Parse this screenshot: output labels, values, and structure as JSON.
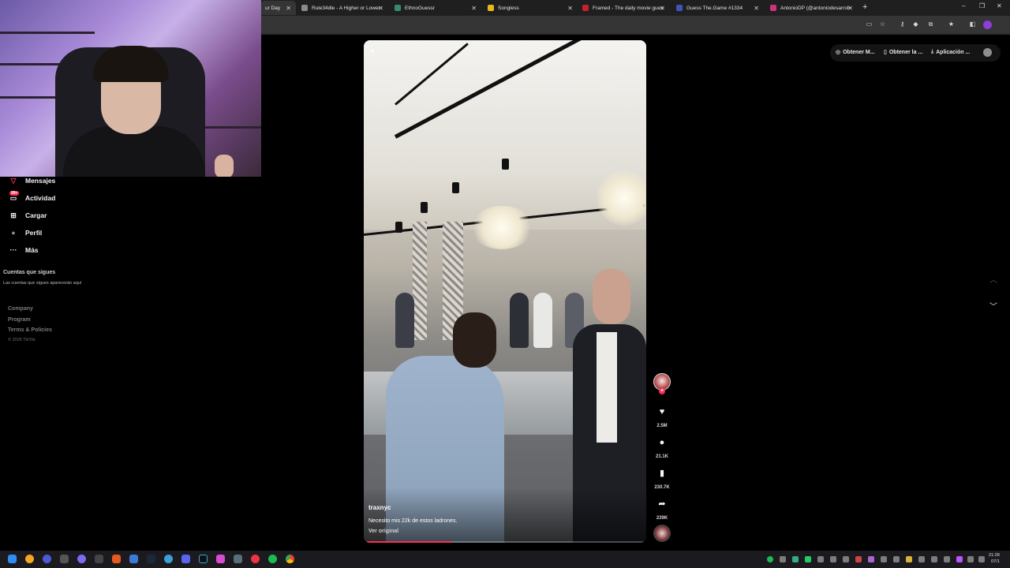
{
  "browser": {
    "tabs": [
      {
        "label": "ur Day",
        "active": true,
        "color": "#2d6fd8"
      },
      {
        "label": "Rule34dle - A Higher or Lower",
        "color": "#8a8a8a"
      },
      {
        "label": "EthnoGuessr",
        "color": "#3a8a6a"
      },
      {
        "label": "Songless",
        "color": "#e5b91a"
      },
      {
        "label": "Framed - The daily movie gues",
        "color": "#c8202a"
      },
      {
        "label": "Guess The.Game #1334",
        "color": "#3e55b8"
      },
      {
        "label": "AntonioDP (@antoniodesarroll",
        "color": "#d1307c"
      }
    ],
    "new_tab": "+",
    "min": "–",
    "max": "❐",
    "close": "✕"
  },
  "sidebar": {
    "items": [
      {
        "label": "Mensajes",
        "icon": "paper-plane-icon",
        "glyph": "▽"
      },
      {
        "label": "Actividad",
        "icon": "inbox-icon",
        "glyph": "▭"
      },
      {
        "label": "Cargar",
        "icon": "upload-icon",
        "glyph": "⊞"
      },
      {
        "label": "Perfil",
        "icon": "profile-avatar-icon",
        "glyph": "●"
      },
      {
        "label": "Más",
        "icon": "more-icon",
        "glyph": "···"
      }
    ],
    "activity_badge": "99+",
    "following_title": "Cuentas que sigues",
    "following_text": "Las cuentas que sigues aparecerán aquí",
    "footer": {
      "links": [
        "Company",
        "Program",
        "Terms & Policies"
      ],
      "copyright": "© 2026 TikTok"
    }
  },
  "promo": {
    "chips": [
      "Obtener M...",
      "Obtener la ...",
      "Aplicación ..."
    ]
  },
  "video": {
    "username": "traxnyc",
    "caption": "Necesito mis 22k de estos ladrones.",
    "original_label": "Ver original",
    "progress": 0.31
  },
  "actions": {
    "likes": "2.5M",
    "comments": "21.1K",
    "saves": "230.7K",
    "shares": "239K"
  },
  "taskbar": {
    "time": "21:28",
    "date": "07/1"
  },
  "colors": {
    "accent": "#fe2c55",
    "background": "#000000"
  }
}
